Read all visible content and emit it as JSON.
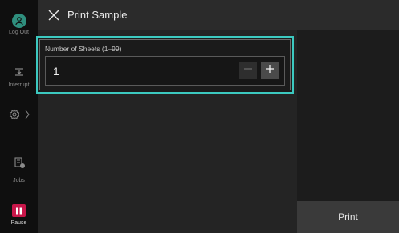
{
  "sidebar": {
    "logout_label": "Log Out",
    "interrupt_label": "Interrupt",
    "jobs_label": "Jobs",
    "pause_label": "Pause"
  },
  "header": {
    "title": "Print Sample"
  },
  "sheets": {
    "label": "Number of Sheets (1–99)",
    "value": "1"
  },
  "actions": {
    "print_label": "Print"
  },
  "colors": {
    "accent_teal": "#3cc9c0",
    "pause_red": "#c8174a",
    "logout_green": "#2f8f7e"
  }
}
